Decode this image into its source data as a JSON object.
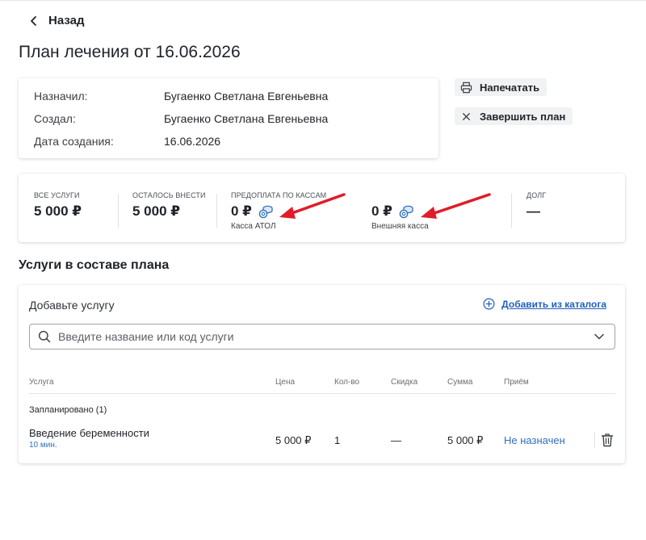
{
  "nav": {
    "back_label": "Назад"
  },
  "page": {
    "title": "План лечения от 16.06.2026"
  },
  "info": {
    "rows": [
      {
        "label": "Назначил:",
        "value": "Бугаенко Светлана Евгеньевна"
      },
      {
        "label": "Создал:",
        "value": "Бугаенко Светлана Евгеньевна"
      },
      {
        "label": "Дата создания:",
        "value": "16.06.2026"
      }
    ]
  },
  "actions": {
    "print_label": "Напечатать",
    "finish_label": "Завершить план"
  },
  "stats": {
    "all_services": {
      "caption": "ВСЕ УСЛУГИ",
      "value": "5 000 ₽"
    },
    "remaining": {
      "caption": "ОСТАЛОСЬ ВНЕСТИ",
      "value": "5 000 ₽"
    },
    "prepayment_caption": "ПРЕДОПЛАТА ПО КАССАМ",
    "registers": [
      {
        "value": "0 ₽",
        "name": "Касса АТОЛ"
      },
      {
        "value": "0 ₽",
        "name": "Внешняя касса"
      }
    ],
    "debt": {
      "caption": "ДОЛГ",
      "value": "—"
    }
  },
  "services": {
    "section_title": "Услуги в составе плана",
    "add_label": "Добавьте услугу",
    "catalog_link": "Добавить из каталога",
    "search_placeholder": "Введите название или код услуги",
    "columns": {
      "service": "Услуга",
      "price": "Цена",
      "qty": "Кол-во",
      "discount": "Скидка",
      "sum": "Сумма",
      "appointment": "Приём"
    },
    "group_label": "Запланировано (1)",
    "rows": [
      {
        "name": "Введение беременности",
        "duration": "10 мин.",
        "price": "5 000 ₽",
        "qty": "1",
        "discount": "—",
        "sum": "5 000 ₽",
        "status": "Не назначен"
      }
    ]
  },
  "colors": {
    "accent": "#1f5fbf",
    "arrow": "#e01c28",
    "status_link": "#2f6fbd"
  },
  "icons": [
    "chevron-left-icon",
    "printer-icon",
    "close-icon",
    "coins-icon",
    "arrow-annotation",
    "plus-circle-icon",
    "search-icon",
    "chevron-down-icon",
    "trash-icon"
  ]
}
